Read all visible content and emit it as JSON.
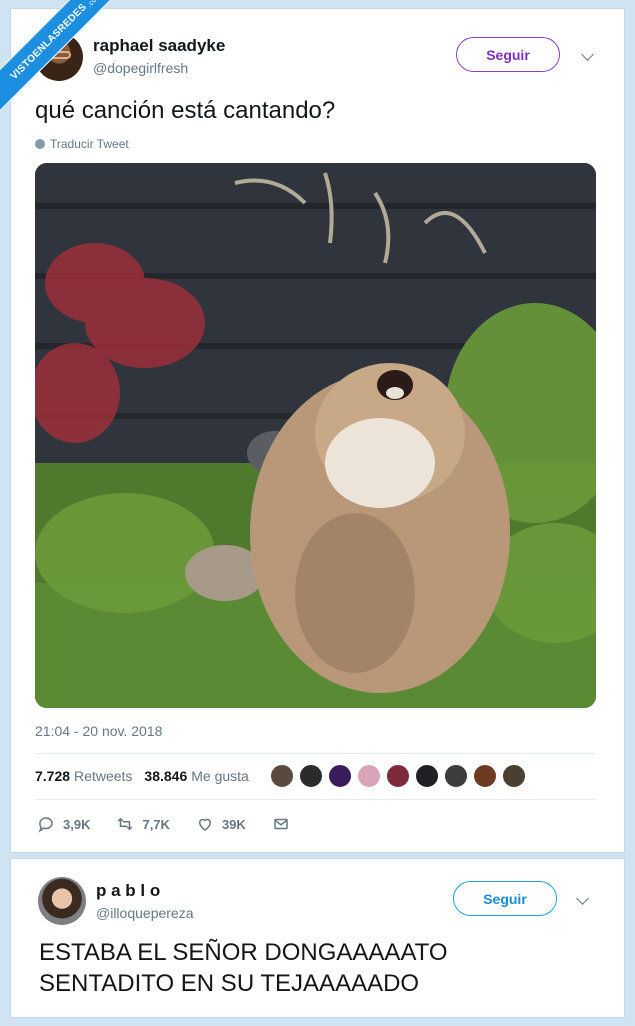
{
  "watermark": {
    "text": "VISTOENLASREDES",
    "suffix": ".com"
  },
  "tweet": {
    "author_name": "raphael saadyke",
    "author_handle": "@dopegirlfresh",
    "follow_label": "Seguir",
    "text": "qué canción está cantando?",
    "translate_label": "Traducir Tweet",
    "timestamp": "21:04 - 20 nov. 2018",
    "retweets_count": "7.728",
    "retweets_label": "Retweets",
    "likes_count": "38.846",
    "likes_label": "Me gusta",
    "likers": [
      "#5a4a3e",
      "#2b2b2b",
      "#3a1c5c",
      "#d9a3b8",
      "#7c2b3a",
      "#1f1f24",
      "#3c3c3c",
      "#6b3b22",
      "#4a3f30"
    ],
    "actions": {
      "replies": "3,9K",
      "retweets": "7,7K",
      "likes": "39K"
    }
  },
  "reply": {
    "author_name": "p a b l o",
    "author_handle": "@illoquepereza",
    "follow_label": "Seguir",
    "text_line1": "ESTABA EL SEÑOR DONGAAAAATO",
    "text_line2": "SENTADITO EN SU TEJAAAAADO"
  },
  "colors": {
    "accent_purple": "#7d2fc8",
    "accent_blue": "#1da1f2",
    "muted": "#657786",
    "watermark": "#1d8fe0"
  }
}
